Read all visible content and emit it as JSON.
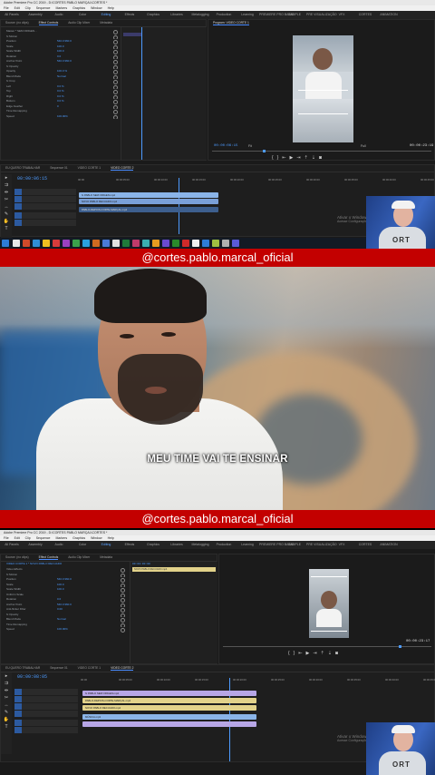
{
  "top_editor": {
    "window_title": "Adobe Premiere Pro CC 2019 - D:\\CORTES PABLO MARÇAL\\CORTES *",
    "menu": [
      "File",
      "Edit",
      "Clip",
      "Sequence",
      "Markers",
      "Graphics",
      "Window",
      "Help"
    ],
    "workspaces": [
      "All Panels",
      "Assembly",
      "Audio",
      "Color",
      "Editing",
      "Effects",
      "Graphics",
      "Libraries",
      "Metalogging",
      "Production",
      "Learning",
      "PREMIERE PRO BASIC",
      "SAMPLE",
      "PRE VISUALIZAÇÃO",
      "VFX",
      "CORTES",
      "ANIMATION"
    ],
    "active_workspace": "Editing",
    "source_tabs": [
      "Source: (no clips)",
      "Effect Controls",
      "Audio Clip Mixer",
      "Metadata"
    ],
    "effect_rows": [
      {
        "label": "Master * SEM ORIGEN...",
        "value": ""
      },
      {
        "label": "fx Motion",
        "value": ""
      },
      {
        "label": "Position",
        "value": "540.0  960.0"
      },
      {
        "label": "Scale",
        "value": "100.0"
      },
      {
        "label": "Scale Width",
        "value": "100.0"
      },
      {
        "label": "Rotation",
        "value": "0.0"
      },
      {
        "label": "Anchor Point",
        "value": "540.0  960.0"
      },
      {
        "label": "fx Opacity",
        "value": ""
      },
      {
        "label": "Opacity",
        "value": "100.0 %"
      },
      {
        "label": "Blend Mode",
        "value": "Normal"
      },
      {
        "label": "fx Crop",
        "value": ""
      },
      {
        "label": "Left",
        "value": "0.0 %"
      },
      {
        "label": "Top",
        "value": "0.0 %"
      },
      {
        "label": "Right",
        "value": "0.0 %"
      },
      {
        "label": "Bottom",
        "value": "0.0 %"
      },
      {
        "label": "Edge Feather",
        "value": "0"
      },
      {
        "label": "Time Remapping",
        "value": ""
      },
      {
        "label": "Speed",
        "value": "100.00%"
      }
    ],
    "program_title": "Program: VIDEO CORTE 1",
    "program_timecode_left": "00:00:06:15",
    "program_fit": "Fit",
    "program_full": "Full",
    "program_timecode_right": "00:00:23:19",
    "timeline_tabs": [
      "EU QUERO TRABALHAR",
      "Sequence 01",
      "VIDEO CORTE 1",
      "VIDEO CORTE 2"
    ],
    "timeline_timecode": "00:00:06:15",
    "ruler_marks": [
      "00:00",
      "00:00:05:00",
      "00:00:10:00",
      "00:00:15:00",
      "00:00:20:00",
      "00:00:25:00",
      "00:00:30:00",
      "00:00:35:00",
      "00:00:40:00",
      "00:00:45:00"
    ],
    "clips": [
      "fx PABLO SEM ORIGEN.mp4",
      "NOVO PABLO RECUADO.mp4",
      "PABLO-DEPOIS-CORTE-MARÇAL.mp4"
    ],
    "watermark_l1": "Ativar o Windows",
    "watermark_l2": "Acesse Configurações"
  },
  "handle_top": "@cortes.pablo.marcal_oficial",
  "subtitle": "MEU TIME VAI TE ENSINAR",
  "handle_bottom": "@cortes.pablo.marcal_oficial",
  "bottom_editor": {
    "window_title": "Adobe Premiere Pro CC 2019 - D:\\CORTES PABLO MARÇAL\\CORTES *",
    "menu": [
      "File",
      "Edit",
      "Clip",
      "Sequence",
      "Markers",
      "Graphics",
      "Window",
      "Help"
    ],
    "workspaces": [
      "All Panels",
      "Assembly",
      "Audio",
      "Color",
      "Editing",
      "Effects",
      "Graphics",
      "Libraries",
      "Metalogging",
      "Production",
      "Learning",
      "PREMIERE PRO BASIC",
      "SAMPLE",
      "PRE VISUALIZAÇÃO",
      "VFX",
      "CORTES",
      "ANIMATION"
    ],
    "active_workspace": "Editing",
    "source_tabs": [
      "Source: (no clips)",
      "Effect Controls",
      "Audio Clip Mixer",
      "Metadata"
    ],
    "effect_header_clip": "VIDEO CORTE 1 * NOVO PABLO RECUADO",
    "effect_rows": [
      {
        "label": "Video Effects",
        "value": ""
      },
      {
        "label": "fx Motion",
        "value": ""
      },
      {
        "label": "Position",
        "value": "540.0  960.0"
      },
      {
        "label": "Scale",
        "value": "100.0"
      },
      {
        "label": "Scale Width",
        "value": "100.0"
      },
      {
        "label": "Uniform Scale",
        "value": ""
      },
      {
        "label": "Rotation",
        "value": "0.0"
      },
      {
        "label": "Anchor Point",
        "value": "540.0  960.0"
      },
      {
        "label": "Anti-flicker Filter",
        "value": "0.00"
      },
      {
        "label": "fx Opacity",
        "value": ""
      },
      {
        "label": "Blend Mode",
        "value": "Normal"
      },
      {
        "label": "Time Remapping",
        "value": ""
      },
      {
        "label": "Speed",
        "value": "100.00%"
      }
    ],
    "effect_timecode": "00:00:00:00",
    "effect_clip_bar": "NOVO PABLO RECUADO.mp4",
    "program_timecode_right": "00:00:23:17",
    "timeline_tabs": [
      "EU QUERO TRABALHAR",
      "Sequence 01",
      "VIDEO CORTE 1",
      "VIDEO CORTE 2"
    ],
    "timeline_timecode": "00:00:08:05",
    "ruler_marks": [
      "00:00",
      "00:00:05:00",
      "00:00:10:00",
      "00:00:15:00",
      "00:00:20:00",
      "00:00:25:00",
      "00:00:30:00",
      "00:00:35:00",
      "00:00:40:00",
      "00:00:45:00"
    ],
    "clips": [
      "fx PABLO SEM ORIGEN.mp4",
      "PABLO-DEPOIS-CORTE-MARÇAL.mp4",
      "NOVO PABLO RECUADO.mp4",
      "MÚSICA.mp3"
    ],
    "watermark_l1": "Ativar o Windows",
    "watermark_l2": "Acesse Configurações"
  },
  "webcam_shirt_text": "ORT",
  "colors": {
    "brand_red": "#c30000",
    "premiere_bg": "#1a1a1a",
    "timecode_blue": "#4d9bff",
    "clip_blue": "#8ab4e8",
    "clip_purple": "#b7a6e6",
    "clip_yellow": "#e2d28a"
  }
}
